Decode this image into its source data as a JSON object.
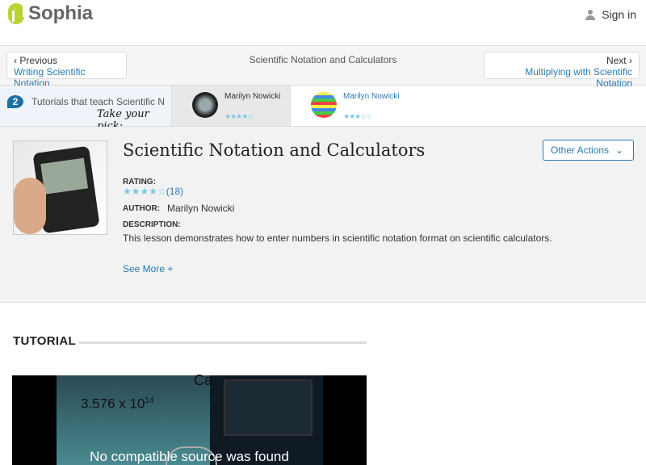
{
  "header": {
    "brand": "Sophia",
    "signin": "Sign in"
  },
  "nav": {
    "prev_label": "Previous",
    "prev_title": "Writing Scientific Notation",
    "current": "Scientific Notation and Calculators",
    "next_label": "Next",
    "next_title": "Multiplying with Scientific Notation"
  },
  "strip": {
    "count": "2",
    "text": "Tutorials that teach Scientific Notation and Calculators",
    "pick": "Take your pick:",
    "tutorials": [
      {
        "author": "Marilyn Nowicki",
        "stars": "★★★★☆",
        "rating": 4
      },
      {
        "author": "Marilyn Nowicki",
        "stars": "★★★☆☆",
        "rating": 3
      }
    ]
  },
  "info": {
    "title": "Scientific Notation and Calculators",
    "other_actions": "Other Actions",
    "rating_label": "RATING:",
    "stars": "★★★★☆",
    "rating": 4,
    "rating_count": "(18)",
    "author_label": "AUTHOR:",
    "author": "Marilyn Nowicki",
    "description_label": "DESCRIPTION:",
    "description": "This lesson demonstrates how to enter numbers in scientific notation format on scientific calculators.",
    "see_more": "See More +"
  },
  "tutorial": {
    "heading": "TUTORIAL",
    "video_base": "3.576 x 10",
    "video_exp": "14",
    "video_partial": "Ca",
    "error": "No compatible source was found"
  }
}
